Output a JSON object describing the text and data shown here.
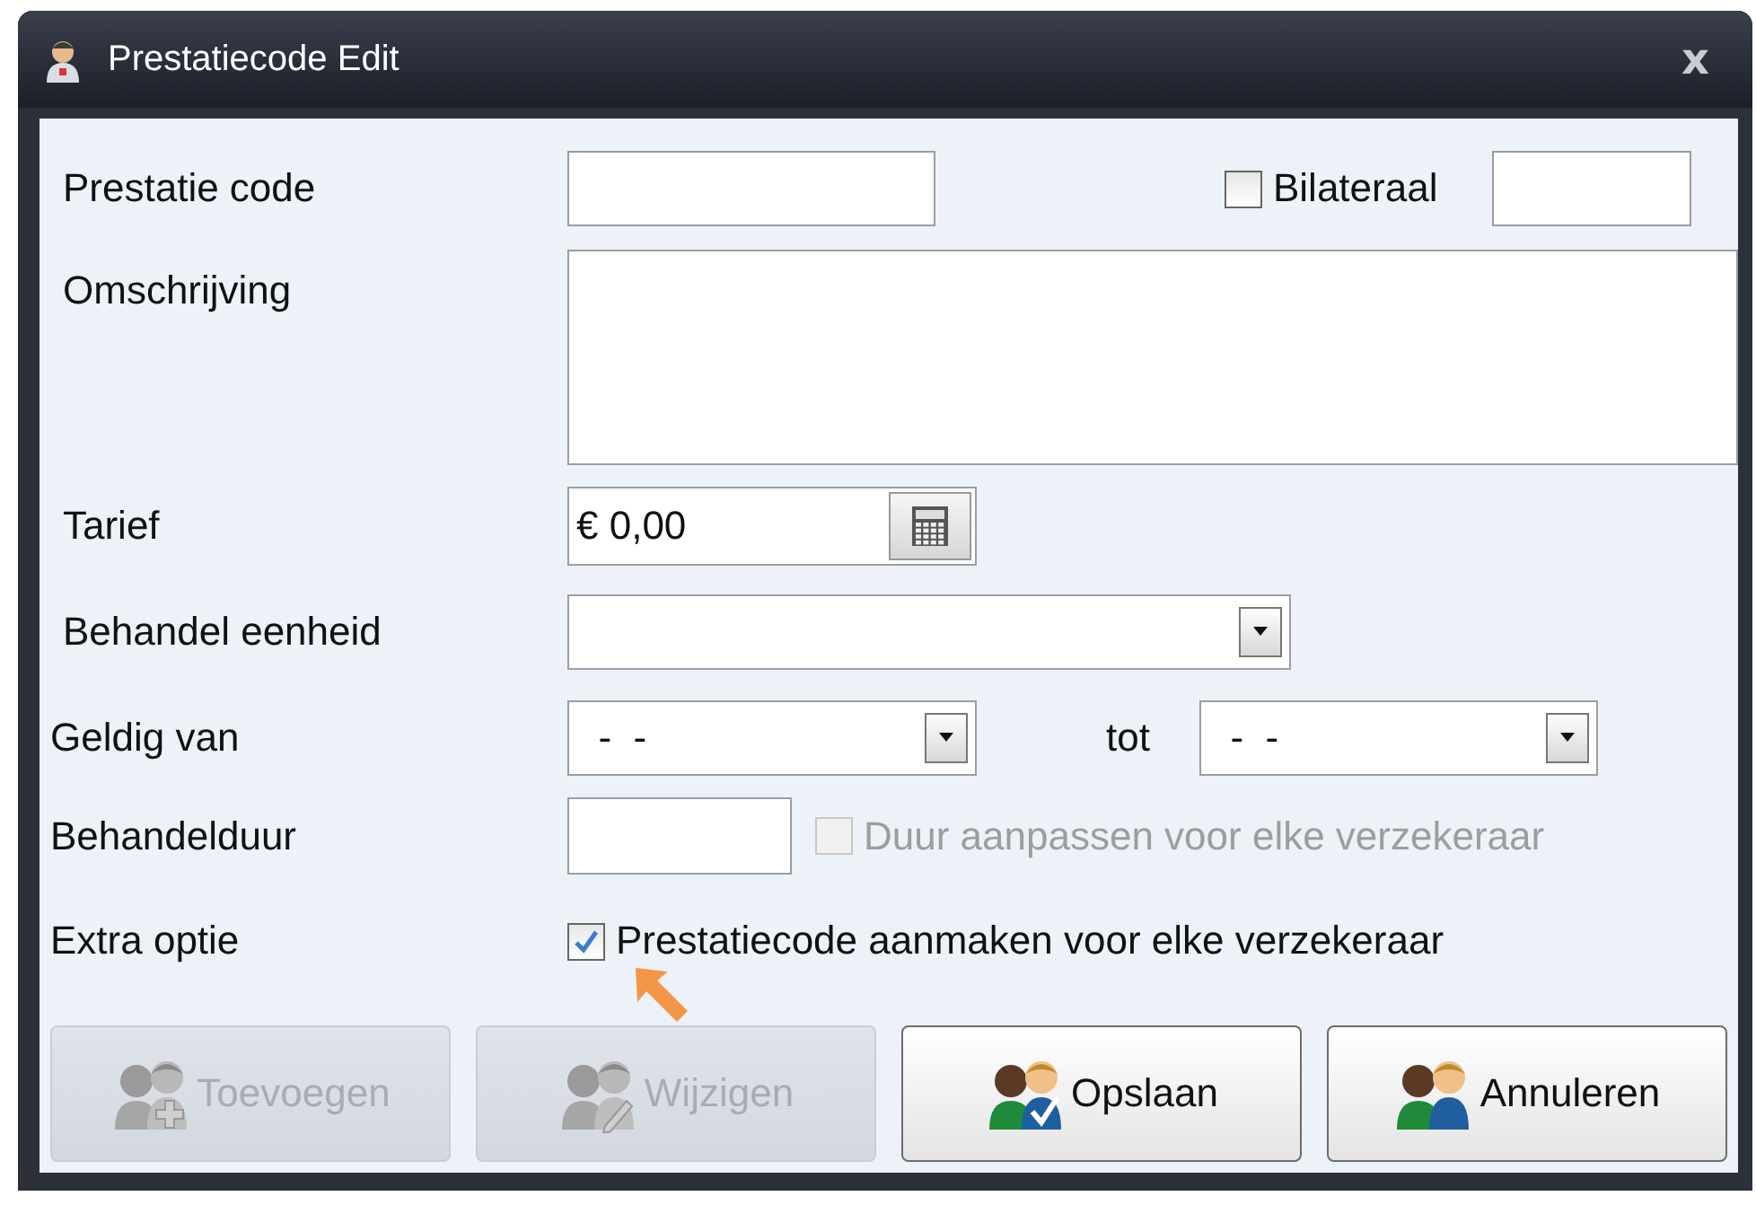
{
  "window": {
    "title": "Prestatiecode Edit",
    "close": "x"
  },
  "prestatie_code": {
    "label": "Prestatie code"
  },
  "bilateraal": {
    "label": "Bilateraal",
    "checked": false
  },
  "omschrijving": {
    "label": "Omschrijving"
  },
  "tarief": {
    "label": "Tarief",
    "value": "€ 0,00"
  },
  "behandel_eenheid": {
    "label": "Behandel eenheid"
  },
  "geldig_van": {
    "label": "Geldig van",
    "value": "-  -"
  },
  "tot": {
    "label": "tot",
    "value": "-  -"
  },
  "behandelduur": {
    "label": "Behandelduur",
    "option": {
      "label": "Duur aanpassen voor elke verzekeraar",
      "checked": false,
      "disabled": true
    }
  },
  "extra_optie": {
    "label": "Extra optie",
    "option": {
      "label": "Prestatiecode aanmaken voor elke verzekeraar",
      "checked": true,
      "disabled": false
    }
  },
  "buttons": [
    {
      "label": "Toevoegen",
      "disabled": true,
      "kind": "add"
    },
    {
      "label": "Wijzigen",
      "disabled": true,
      "kind": "edit"
    },
    {
      "label": "Opslaan",
      "disabled": false,
      "kind": "save"
    },
    {
      "label": "Annuleren",
      "disabled": false,
      "kind": "cancel"
    }
  ]
}
